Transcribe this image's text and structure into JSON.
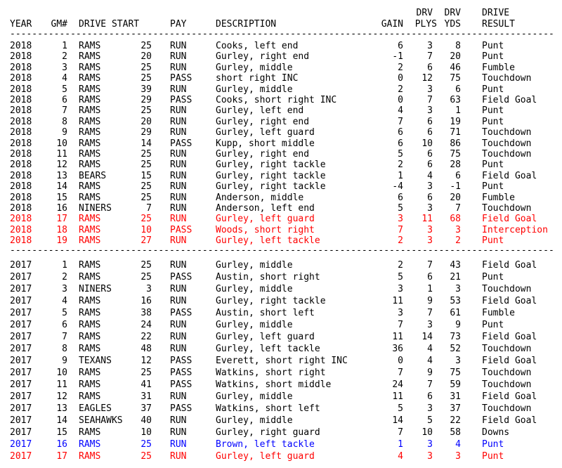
{
  "header": {
    "line1": {
      "drv_plys": "DRV",
      "drv_yds": "DRV",
      "drive_result": "DRIVE"
    },
    "line2": {
      "year": "YEAR",
      "gm": "GM#",
      "drive_start": "DRIVE START",
      "pay": "PAY",
      "description": "DESCRIPTION",
      "gain": "GAIN",
      "plys": "PLYS",
      "yds": "YDS",
      "result": "RESULT"
    }
  },
  "separator": "-----------------------------------------------------------------------------------------------------",
  "colors": {
    "default": "#000000",
    "red": "#ff0000",
    "blue": "#0000ff"
  },
  "rows_2018": [
    {
      "year": "2018",
      "gm": "1",
      "team": "RAMS",
      "start": "25",
      "pay": "RUN",
      "desc": "Cooks, left end",
      "gain": "6",
      "plys": "3",
      "yds": "8",
      "result": "Punt",
      "color": "default"
    },
    {
      "year": "2018",
      "gm": "2",
      "team": "RAMS",
      "start": "20",
      "pay": "RUN",
      "desc": "Gurley, right end",
      "gain": "-1",
      "plys": "7",
      "yds": "20",
      "result": "Punt",
      "color": "default"
    },
    {
      "year": "2018",
      "gm": "3",
      "team": "RAMS",
      "start": "25",
      "pay": "RUN",
      "desc": "Gurley, middle",
      "gain": "2",
      "plys": "6",
      "yds": "46",
      "result": "Fumble",
      "color": "default"
    },
    {
      "year": "2018",
      "gm": "4",
      "team": "RAMS",
      "start": "25",
      "pay": "PASS",
      "desc": "short right INC",
      "gain": "0",
      "plys": "12",
      "yds": "75",
      "result": "Touchdown",
      "color": "default"
    },
    {
      "year": "2018",
      "gm": "5",
      "team": "RAMS",
      "start": "39",
      "pay": "RUN",
      "desc": "Gurley, middle",
      "gain": "2",
      "plys": "3",
      "yds": "6",
      "result": "Punt",
      "color": "default"
    },
    {
      "year": "2018",
      "gm": "6",
      "team": "RAMS",
      "start": "29",
      "pay": "PASS",
      "desc": "Cooks, short right INC",
      "gain": "0",
      "plys": "7",
      "yds": "63",
      "result": "Field Goal",
      "color": "default"
    },
    {
      "year": "2018",
      "gm": "7",
      "team": "RAMS",
      "start": "25",
      "pay": "RUN",
      "desc": "Gurley, left end",
      "gain": "4",
      "plys": "3",
      "yds": "1",
      "result": "Punt",
      "color": "default"
    },
    {
      "year": "2018",
      "gm": "8",
      "team": "RAMS",
      "start": "20",
      "pay": "RUN",
      "desc": "Gurley, right end",
      "gain": "7",
      "plys": "6",
      "yds": "19",
      "result": "Punt",
      "color": "default"
    },
    {
      "year": "2018",
      "gm": "9",
      "team": "RAMS",
      "start": "29",
      "pay": "RUN",
      "desc": "Gurley, left guard",
      "gain": "6",
      "plys": "6",
      "yds": "71",
      "result": "Touchdown",
      "color": "default"
    },
    {
      "year": "2018",
      "gm": "10",
      "team": "RAMS",
      "start": "14",
      "pay": "PASS",
      "desc": "Kupp, short middle",
      "gain": "6",
      "plys": "10",
      "yds": "86",
      "result": "Touchdown",
      "color": "default"
    },
    {
      "year": "2018",
      "gm": "11",
      "team": "RAMS",
      "start": "25",
      "pay": "RUN",
      "desc": "Gurley, right end",
      "gain": "5",
      "plys": "6",
      "yds": "75",
      "result": "Touchdown",
      "color": "default"
    },
    {
      "year": "2018",
      "gm": "12",
      "team": "RAMS",
      "start": "25",
      "pay": "RUN",
      "desc": "Gurley, right tackle",
      "gain": "2",
      "plys": "6",
      "yds": "28",
      "result": "Punt",
      "color": "default"
    },
    {
      "year": "2018",
      "gm": "13",
      "team": "BEARS",
      "start": "15",
      "pay": "RUN",
      "desc": "Gurley, right tackle",
      "gain": "1",
      "plys": "4",
      "yds": "6",
      "result": "Field Goal",
      "color": "default"
    },
    {
      "year": "2018",
      "gm": "14",
      "team": "RAMS",
      "start": "25",
      "pay": "RUN",
      "desc": "Gurley, right tackle",
      "gain": "-4",
      "plys": "3",
      "yds": "-1",
      "result": "Punt",
      "color": "default"
    },
    {
      "year": "2018",
      "gm": "15",
      "team": "RAMS",
      "start": "25",
      "pay": "RUN",
      "desc": "Anderson, middle",
      "gain": "6",
      "plys": "6",
      "yds": "20",
      "result": "Fumble",
      "color": "default"
    },
    {
      "year": "2018",
      "gm": "16",
      "team": "NINERS",
      "start": "7",
      "pay": "RUN",
      "desc": "Anderson, left end",
      "gain": "5",
      "plys": "3",
      "yds": "7",
      "result": "Touchdown",
      "color": "default"
    },
    {
      "year": "2018",
      "gm": "17",
      "team": "RAMS",
      "start": "25",
      "pay": "RUN",
      "desc": "Gurley, left guard",
      "gain": "3",
      "plys": "11",
      "yds": "68",
      "result": "Field Goal",
      "color": "red"
    },
    {
      "year": "2018",
      "gm": "18",
      "team": "RAMS",
      "start": "10",
      "pay": "PASS",
      "desc": "Woods, short right",
      "gain": "7",
      "plys": "3",
      "yds": "3",
      "result": "Interception",
      "color": "red"
    },
    {
      "year": "2018",
      "gm": "19",
      "team": "RAMS",
      "start": "27",
      "pay": "RUN",
      "desc": "Gurley, left tackle",
      "gain": "2",
      "plys": "3",
      "yds": "2",
      "result": "Punt",
      "color": "red"
    }
  ],
  "rows_2017": [
    {
      "year": "2017",
      "gm": "1",
      "team": "RAMS",
      "start": "25",
      "pay": "RUN",
      "desc": "Gurley, middle",
      "gain": "2",
      "plys": "7",
      "yds": "43",
      "result": "Field Goal",
      "color": "default"
    },
    {
      "year": "2017",
      "gm": "2",
      "team": "RAMS",
      "start": "25",
      "pay": "PASS",
      "desc": "Austin, short right",
      "gain": "5",
      "plys": "6",
      "yds": "21",
      "result": "Punt",
      "color": "default"
    },
    {
      "year": "2017",
      "gm": "3",
      "team": "NINERS",
      "start": "3",
      "pay": "RUN",
      "desc": "Gurley, middle",
      "gain": "3",
      "plys": "1",
      "yds": "3",
      "result": "Touchdown",
      "color": "default"
    },
    {
      "year": "2017",
      "gm": "4",
      "team": "RAMS",
      "start": "16",
      "pay": "RUN",
      "desc": "Gurley, right tackle",
      "gain": "11",
      "plys": "9",
      "yds": "53",
      "result": "Field Goal",
      "color": "default"
    },
    {
      "year": "2017",
      "gm": "5",
      "team": "RAMS",
      "start": "38",
      "pay": "PASS",
      "desc": "Austin, short left",
      "gain": "3",
      "plys": "7",
      "yds": "61",
      "result": "Fumble",
      "color": "default"
    },
    {
      "year": "2017",
      "gm": "6",
      "team": "RAMS",
      "start": "24",
      "pay": "RUN",
      "desc": "Gurley, middle",
      "gain": "7",
      "plys": "3",
      "yds": "9",
      "result": "Punt",
      "color": "default"
    },
    {
      "year": "2017",
      "gm": "7",
      "team": "RAMS",
      "start": "22",
      "pay": "RUN",
      "desc": "Gurley, left guard",
      "gain": "11",
      "plys": "14",
      "yds": "73",
      "result": "Field Goal",
      "color": "default"
    },
    {
      "year": "2017",
      "gm": "8",
      "team": "RAMS",
      "start": "48",
      "pay": "RUN",
      "desc": "Gurley, left tackle",
      "gain": "36",
      "plys": "4",
      "yds": "52",
      "result": "Touchdown",
      "color": "default"
    },
    {
      "year": "2017",
      "gm": "9",
      "team": "TEXANS",
      "start": "12",
      "pay": "PASS",
      "desc": "Everett, short right INC",
      "gain": "0",
      "plys": "4",
      "yds": "3",
      "result": "Field Goal",
      "color": "default"
    },
    {
      "year": "2017",
      "gm": "10",
      "team": "RAMS",
      "start": "25",
      "pay": "PASS",
      "desc": "Watkins, short right",
      "gain": "7",
      "plys": "9",
      "yds": "75",
      "result": "Touchdown",
      "color": "default"
    },
    {
      "year": "2017",
      "gm": "11",
      "team": "RAMS",
      "start": "41",
      "pay": "PASS",
      "desc": "Watkins, short middle",
      "gain": "24",
      "plys": "7",
      "yds": "59",
      "result": "Touchdown",
      "color": "default"
    },
    {
      "year": "2017",
      "gm": "12",
      "team": "RAMS",
      "start": "31",
      "pay": "RUN",
      "desc": "Gurley, middle",
      "gain": "11",
      "plys": "6",
      "yds": "31",
      "result": "Field Goal",
      "color": "default"
    },
    {
      "year": "2017",
      "gm": "13",
      "team": "EAGLES",
      "start": "37",
      "pay": "PASS",
      "desc": "Watkins, short left",
      "gain": "5",
      "plys": "3",
      "yds": "37",
      "result": "Touchdown",
      "color": "default"
    },
    {
      "year": "2017",
      "gm": "14",
      "team": "SEAHAWKS",
      "start": "40",
      "pay": "RUN",
      "desc": "Gurley, middle",
      "gain": "14",
      "plys": "5",
      "yds": "22",
      "result": "Field Goal",
      "color": "default"
    },
    {
      "year": "2017",
      "gm": "15",
      "team": "RAMS",
      "start": "10",
      "pay": "RUN",
      "desc": "Gurley, right guard",
      "gain": "7",
      "plys": "10",
      "yds": "58",
      "result": "Downs",
      "color": "default"
    },
    {
      "year": "2017",
      "gm": "16",
      "team": "RAMS",
      "start": "25",
      "pay": "RUN",
      "desc": "Brown, left tackle",
      "gain": "1",
      "plys": "3",
      "yds": "4",
      "result": "Punt",
      "color": "blue"
    },
    {
      "year": "2017",
      "gm": "17",
      "team": "RAMS",
      "start": "25",
      "pay": "RUN",
      "desc": "Gurley, left guard",
      "gain": "4",
      "plys": "3",
      "yds": "3",
      "result": "Punt",
      "color": "red"
    }
  ]
}
